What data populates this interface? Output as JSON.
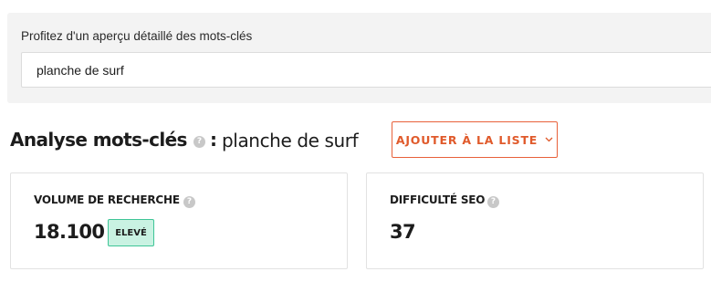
{
  "search": {
    "label": "Profitez d'un aperçu détaillé des mots-clés",
    "value": "planche de surf"
  },
  "header": {
    "title": "Analyse mots-clés",
    "colon": ":",
    "keyword": "planche de surf",
    "add_button_label": "AJOUTER À LA LISTE",
    "help_glyph": "?"
  },
  "metrics": {
    "volume": {
      "label": "VOLUME DE RECHERCHE",
      "value": "18.100",
      "badge": "ELEVÉ",
      "badge_color": "#c9f2e2"
    },
    "seo": {
      "label": "DIFFICULTÉ SEO",
      "value": "37"
    }
  },
  "colors": {
    "accent": "#e05a2b",
    "panel_bg": "#f3f3f3",
    "badge_border": "#3fc597"
  }
}
